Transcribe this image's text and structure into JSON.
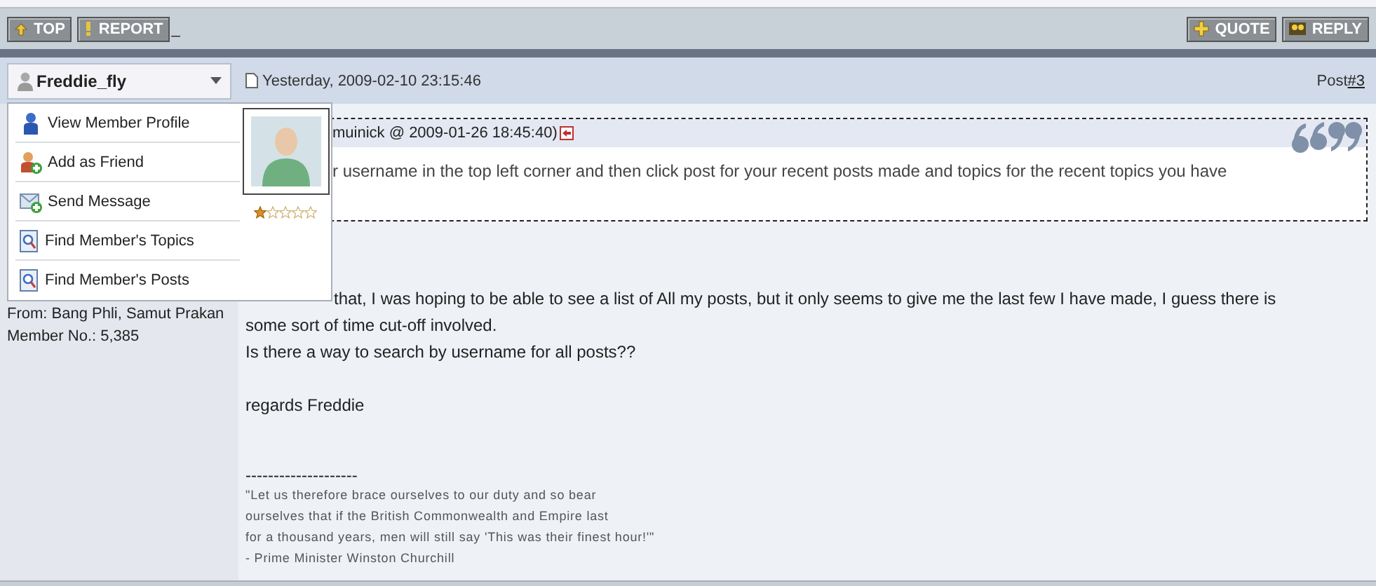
{
  "toolbar": {
    "left_buttons": [
      {
        "label": "TOP",
        "kind": "top"
      },
      {
        "label": "REPORT",
        "kind": "report"
      }
    ],
    "trailing_mark": "_",
    "right_buttons": [
      {
        "label": "QUOTE",
        "kind": "quote"
      },
      {
        "label": "REPLY",
        "kind": "reply"
      }
    ]
  },
  "post_header": {
    "username": "Freddie_fly",
    "date": "Yesterday, 2009-02-10 23:15:46",
    "post_label": "Post",
    "post_number": "#3"
  },
  "user_menu": {
    "items": [
      {
        "label": "View Member Profile",
        "kind": "profile"
      },
      {
        "label": "Add as Friend",
        "kind": "friend"
      },
      {
        "label": "Send Message",
        "kind": "message"
      },
      {
        "label": "Find Member's Topics",
        "kind": "find"
      },
      {
        "label": "Find Member's Posts",
        "kind": "find"
      }
    ],
    "stars": 1
  },
  "profile": {
    "from": "From: Bang Phli, Samut Prakan",
    "member_no": "Member No.: 5,385"
  },
  "quote": {
    "header": "muinick @ 2009-01-26 18:45:40)",
    "text": "r username in the top left corner and then click post for your recent posts made and topics for the recent topics you have"
  },
  "body": {
    "paragraphs": [
      "that, I was hoping to be able to see a list of All my posts, but it only seems to give me the last few I have made, I guess there is some sort of time cut-off involved.",
      "Is there a way to search by username for all posts??",
      "regards Freddie"
    ]
  },
  "signature": {
    "separator": "--------------------",
    "lines": [
      "\"Let us therefore brace ourselves to our duty and so bear",
      "ourselves that if the British Commonwealth and Empire last",
      "for a thousand years, men will still say 'This was their finest hour!'\"",
      "- Prime Minister Winston Churchill"
    ]
  }
}
